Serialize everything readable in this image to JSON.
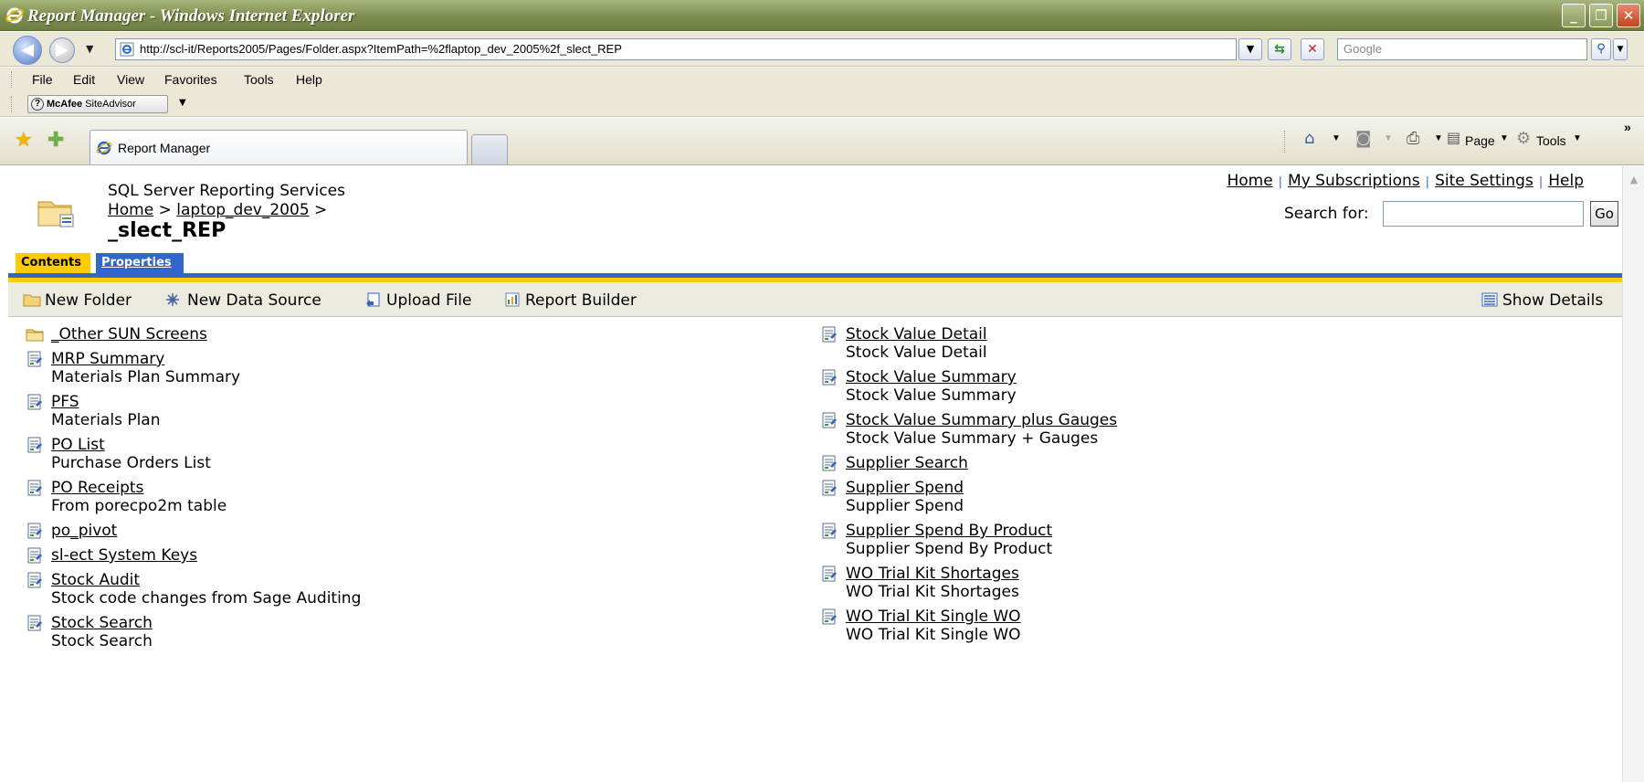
{
  "browser": {
    "title": "Report Manager - Windows Internet Explorer",
    "url": "http://scl-it/Reports2005/Pages/Folder.aspx?ItemPath=%2flaptop_dev_2005%2f_slect_REP",
    "search_placeholder": "Google",
    "menu": [
      "File",
      "Edit",
      "View",
      "Favorites",
      "Tools",
      "Help"
    ],
    "mcafee_brand": "McAfee",
    "mcafee_label": "SiteAdvisor",
    "tab_label": "Report Manager",
    "cmd_page": "Page",
    "cmd_tools": "Tools"
  },
  "header": {
    "app_name": "SQL Server Reporting Services",
    "breadcrumb_home": "Home",
    "breadcrumb_sep": ">",
    "breadcrumb_folder": "laptop_dev_2005",
    "page_title": "_slect_REP",
    "links": [
      "Home",
      "My Subscriptions",
      "Site Settings",
      "Help"
    ],
    "search_label": "Search for:",
    "go_label": "Go"
  },
  "tabs": {
    "contents": "Contents",
    "properties": "Properties"
  },
  "toolbar": {
    "new_folder": "New Folder",
    "new_data_source": "New Data Source",
    "upload_file": "Upload File",
    "report_builder": "Report Builder",
    "show_details": "Show Details"
  },
  "items_left": [
    {
      "name": "_Other SUN Screens",
      "desc": "",
      "icon": "folder-icon"
    },
    {
      "name": "MRP Summary",
      "desc": "Materials Plan Summary",
      "icon": "report-icon"
    },
    {
      "name": "PFS",
      "desc": "Materials Plan",
      "icon": "report-icon"
    },
    {
      "name": "PO List",
      "desc": "Purchase Orders List",
      "icon": "report-icon"
    },
    {
      "name": "PO Receipts",
      "desc": "From porecpo2m table",
      "icon": "report-icon"
    },
    {
      "name": "po_pivot",
      "desc": "",
      "icon": "report-icon"
    },
    {
      "name": "sl-ect System Keys",
      "desc": "",
      "icon": "report-icon"
    },
    {
      "name": "Stock Audit",
      "desc": "Stock code changes from Sage Auditing",
      "icon": "report-icon"
    },
    {
      "name": "Stock Search",
      "desc": "Stock Search",
      "icon": "report-icon"
    }
  ],
  "items_right": [
    {
      "name": "Stock Value Detail",
      "desc": "Stock Value Detail",
      "icon": "report-icon"
    },
    {
      "name": "Stock Value Summary",
      "desc": "Stock Value Summary",
      "icon": "report-icon"
    },
    {
      "name": "Stock Value Summary plus Gauges",
      "desc": "Stock Value Summary + Gauges",
      "icon": "report-icon"
    },
    {
      "name": "Supplier Search",
      "desc": "",
      "icon": "report-icon"
    },
    {
      "name": "Supplier Spend",
      "desc": "Supplier Spend",
      "icon": "report-icon"
    },
    {
      "name": "Supplier Spend By Product",
      "desc": "Supplier Spend By Product",
      "icon": "report-icon"
    },
    {
      "name": "WO Trial Kit Shortages",
      "desc": "WO Trial Kit Shortages",
      "icon": "report-icon"
    },
    {
      "name": "WO Trial Kit Single WO",
      "desc": "WO Trial Kit Single WO",
      "icon": "report-icon"
    }
  ]
}
